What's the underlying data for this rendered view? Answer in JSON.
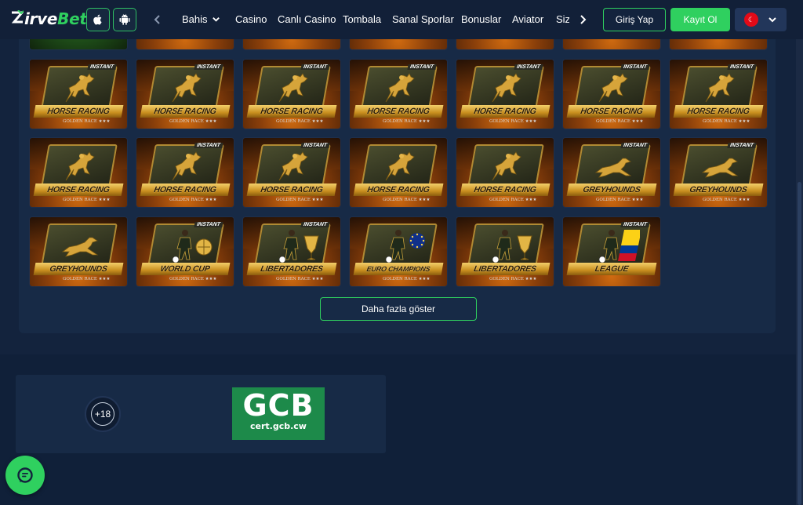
{
  "header": {
    "logo": {
      "prefix": "Z",
      "main": "irve",
      "accent": "Bet"
    },
    "apps": [
      {
        "name": "apple",
        "icon": "apple-icon"
      },
      {
        "name": "android",
        "icon": "android-icon"
      }
    ],
    "nav_items": [
      {
        "label": "Bahis",
        "has_dropdown": true
      },
      {
        "label": "Casino"
      },
      {
        "label": "Canlı Casino"
      },
      {
        "label": "Tombala"
      },
      {
        "label": "Sanal Sporlar"
      },
      {
        "label": "Bonuslar"
      },
      {
        "label": "Aviator"
      },
      {
        "label": "Sizi"
      }
    ],
    "login_label": "Giriş Yap",
    "register_label": "Kayıt Ol",
    "language": {
      "flag": "turkey-flag-icon",
      "flag_color": "#e30a17"
    }
  },
  "games": {
    "tiles": [
      {
        "title": "",
        "type": "partial"
      },
      {
        "title": "",
        "type": "partial"
      },
      {
        "title": "",
        "type": "partial"
      },
      {
        "title": "",
        "type": "partial"
      },
      {
        "title": "",
        "type": "partial"
      },
      {
        "title": "",
        "type": "partial"
      },
      {
        "title": "",
        "type": "partial"
      },
      {
        "title": "HORSE RACING",
        "type": "horse",
        "badge": "INSTANT",
        "brand": "GOLDEN RACE ★★★"
      },
      {
        "title": "HORSE RACING",
        "type": "horse",
        "badge": "INSTANT",
        "brand": "GOLDEN RACE ★★★"
      },
      {
        "title": "HORSE RACING",
        "type": "horse",
        "badge": "INSTANT",
        "brand": "GOLDEN RACE ★★★"
      },
      {
        "title": "HORSE RACING",
        "type": "horse",
        "badge": "INSTANT",
        "brand": "GOLDEN RACE ★★★"
      },
      {
        "title": "HORSE RACING",
        "type": "horse",
        "badge": "INSTANT",
        "brand": "GOLDEN RACE ★★★"
      },
      {
        "title": "HORSE RACING",
        "type": "horse",
        "badge": "INSTANT",
        "brand": "GOLDEN RACE ★★★"
      },
      {
        "title": "HORSE RACING",
        "type": "horse",
        "badge": "INSTANT",
        "brand": "GOLDEN RACE ★★★"
      },
      {
        "title": "HORSE RACING",
        "type": "horse",
        "badge": "",
        "brand": "GOLDEN RACE ★★★"
      },
      {
        "title": "HORSE RACING",
        "type": "horse",
        "badge": "INSTANT",
        "brand": "GOLDEN RACE ★★★"
      },
      {
        "title": "HORSE RACING",
        "type": "horse",
        "badge": "INSTANT",
        "brand": "GOLDEN RACE ★★★"
      },
      {
        "title": "HORSE RACING",
        "type": "horse",
        "badge": "",
        "brand": "GOLDEN RACE ★★★"
      },
      {
        "title": "HORSE RACING",
        "type": "horse",
        "badge": "",
        "brand": "GOLDEN RACE ★★★"
      },
      {
        "title": "GREYHOUNDS",
        "type": "dog",
        "badge": "INSTANT",
        "brand": "GOLDEN RACE ★★★"
      },
      {
        "title": "GREYHOUNDS",
        "type": "dog",
        "badge": "INSTANT",
        "brand": "GOLDEN RACE ★★★"
      },
      {
        "title": "GREYHOUNDS",
        "type": "dog",
        "badge": "",
        "brand": "GOLDEN RACE ★★★"
      },
      {
        "title": "WORLD CUP",
        "type": "soccer",
        "badge": "INSTANT",
        "brand": "GOLDEN RACE ★★★",
        "emblem": "globe"
      },
      {
        "title": "LIBERTADORES",
        "type": "soccer",
        "badge": "INSTANT",
        "brand": "GOLDEN RACE ★★★",
        "emblem": "cup"
      },
      {
        "title": "EURO CHAMPIONS",
        "type": "soccer",
        "badge": "",
        "brand": "GOLDEN RACE ★★★",
        "emblem": "stars"
      },
      {
        "title": "LIBERTADORES",
        "type": "soccer",
        "badge": "",
        "brand": "GOLDEN RACE ★★★",
        "emblem": "cup"
      },
      {
        "title": "LEAGUE",
        "type": "soccer",
        "badge": "INSTANT",
        "brand": "",
        "emblem": "colombia"
      }
    ],
    "show_more_label": "Daha fazla göster"
  },
  "footer": {
    "age_label": "+18",
    "license": {
      "title": "GCB",
      "url": "cert.gcb.cw"
    },
    "chat": "chat-icon"
  },
  "colors": {
    "accent": "#2fd05f",
    "background": "#13233d",
    "panel": "#172a46",
    "gold": "#c98f1f"
  }
}
